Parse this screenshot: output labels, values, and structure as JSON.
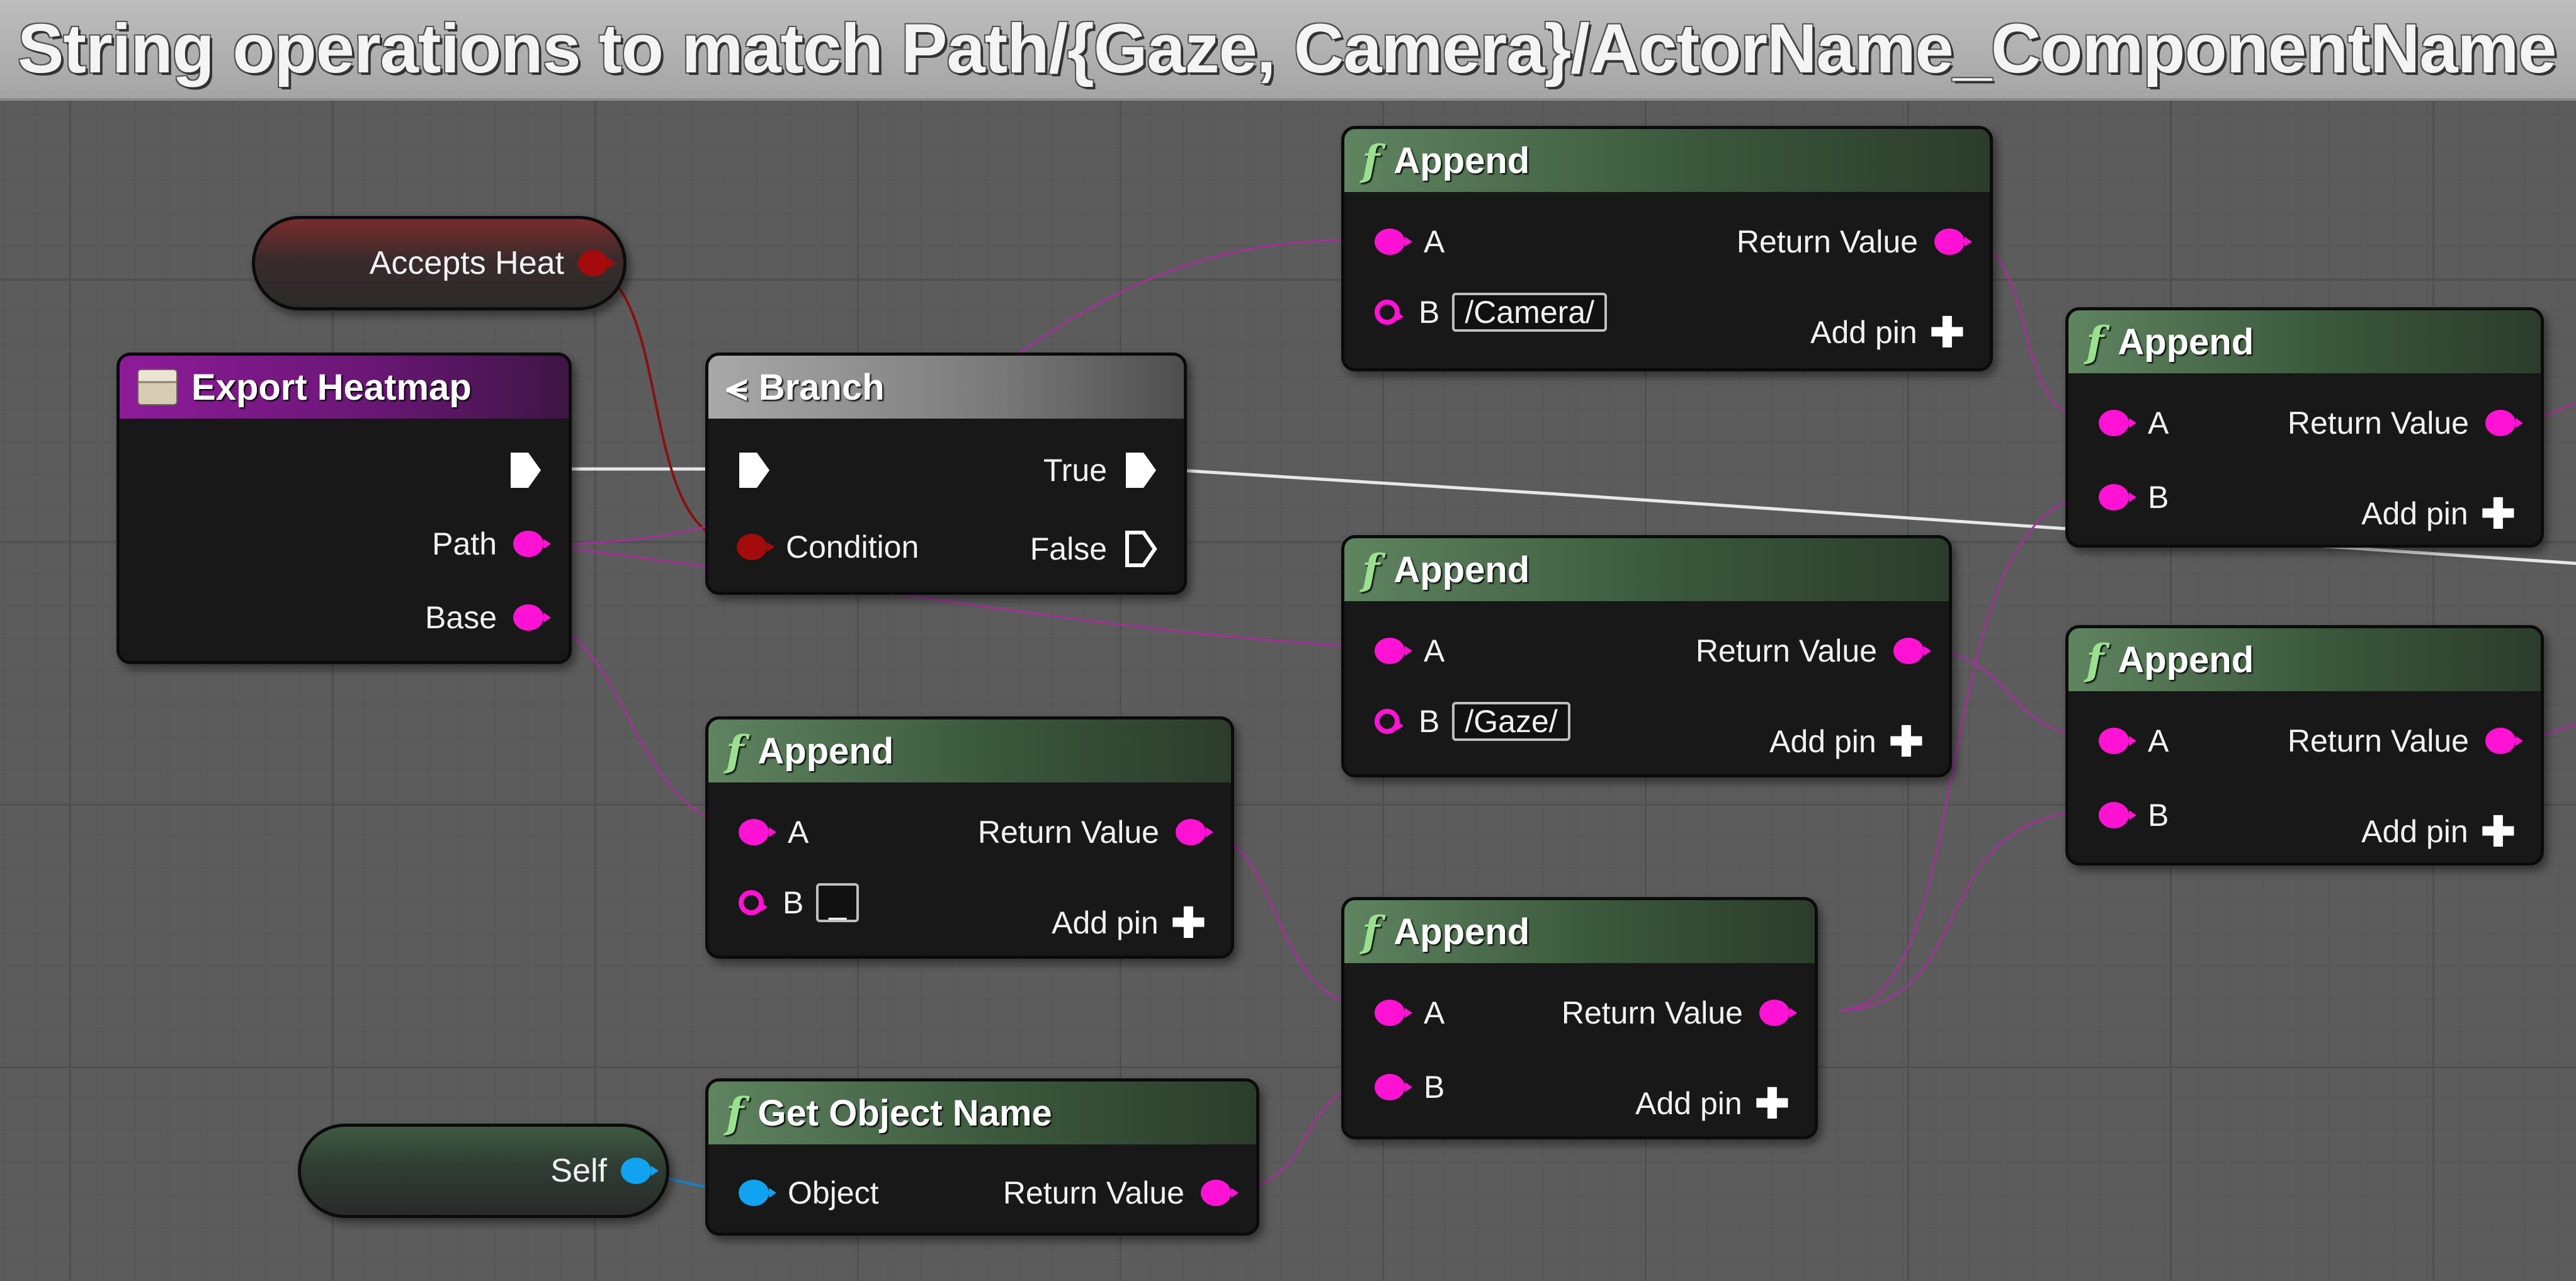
{
  "comment": {
    "title": "String operations to match Path/{Gaze, Camera}/ActorName_ComponentName"
  },
  "colors": {
    "string_pin": "#ff12d4",
    "bool_pin": "#a40b0b",
    "object_pin": "#10a3f0",
    "exec_pin": "#ffffff",
    "function_header": "#5f8460",
    "event_header": "#8e1b9a"
  },
  "accepts_heat": {
    "label": "Accepts Heat",
    "pin_icon": "bool-pin"
  },
  "self_node": {
    "label": "Self",
    "pin_icon": "object-pin"
  },
  "export_heatmap": {
    "title": "Export Heatmap",
    "icon": "event-icon",
    "pins": {
      "path": "Path",
      "base": "Base"
    }
  },
  "branch": {
    "title": "Branch",
    "icon": "branch-icon",
    "condition": "Condition",
    "true": "True",
    "false": "False"
  },
  "append_camera": {
    "title": "Append",
    "a": "A",
    "b": "B",
    "b_value": "/Camera/",
    "return": "Return Value",
    "add_pin": "Add pin"
  },
  "append_gaze": {
    "title": "Append",
    "a": "A",
    "b": "B",
    "b_value": "/Gaze/",
    "return": "Return Value",
    "add_pin": "Add pin"
  },
  "append_underscore": {
    "title": "Append",
    "a": "A",
    "b": "B",
    "b_value": "_",
    "return": "Return Value",
    "add_pin": "Add pin"
  },
  "append_object": {
    "title": "Append",
    "a": "A",
    "b": "B",
    "return": "Return Value",
    "add_pin": "Add pin"
  },
  "append_top_right": {
    "title": "Append",
    "a": "A",
    "b": "B",
    "return": "Return Value",
    "add_pin": "Add pin"
  },
  "append_mid_right": {
    "title": "Append",
    "a": "A",
    "b": "B",
    "return": "Return Value",
    "add_pin": "Add pin"
  },
  "get_object_name": {
    "title": "Get Object Name",
    "object": "Object",
    "return": "Return Value"
  }
}
